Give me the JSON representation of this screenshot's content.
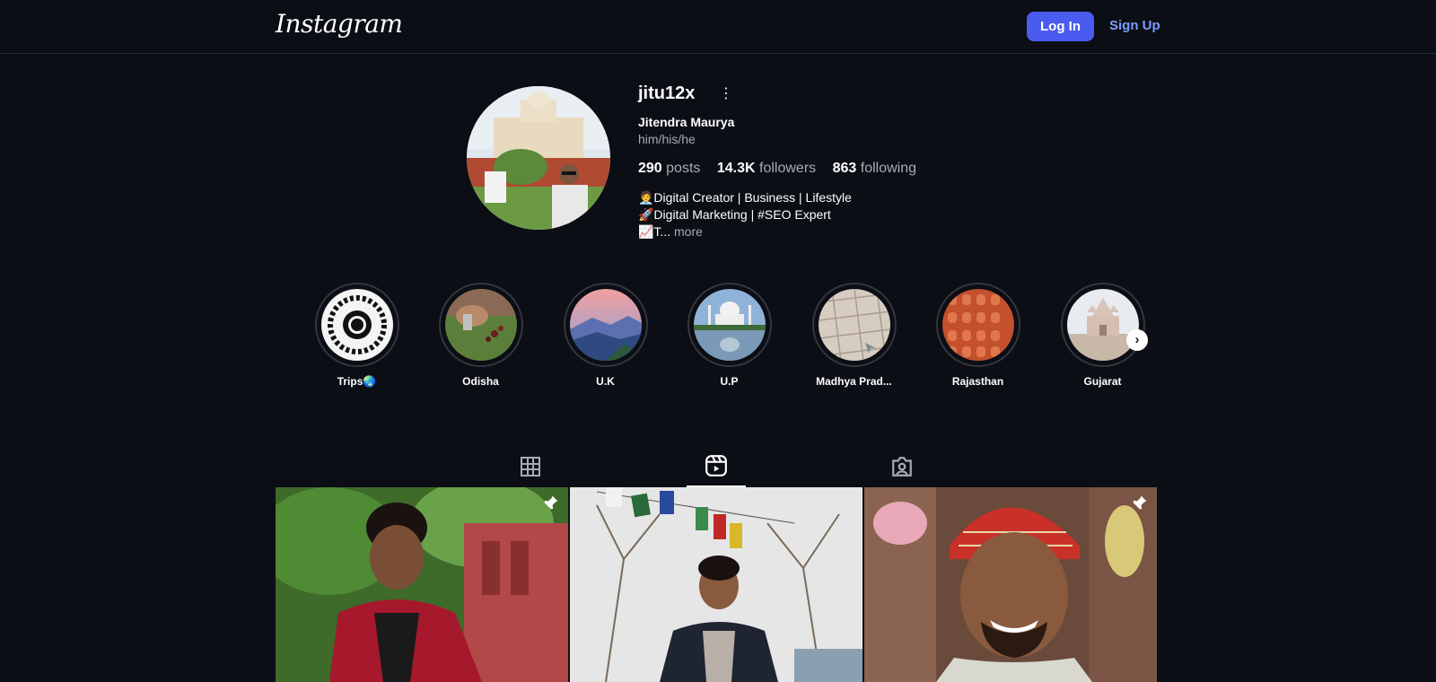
{
  "header": {
    "logo": "Instagram",
    "login_label": "Log In",
    "signup_label": "Sign Up"
  },
  "profile": {
    "username": "jitu12x",
    "full_name": "Jitendra Maurya",
    "pronouns": "him/his/he",
    "stats": {
      "posts_count": "290",
      "posts_label": "posts",
      "followers_count": "14.3K",
      "followers_label": "followers",
      "following_count": "863",
      "following_label": "following"
    },
    "bio": {
      "line1": "🧑‍💼Digital Creator | Business | Lifestyle",
      "line2": "🚀Digital Marketing | #SEO Expert",
      "line3": "📈T...",
      "more": "more"
    }
  },
  "highlights": [
    {
      "label": "Trips🌏",
      "icon": "trips-globe-image"
    },
    {
      "label": "Odisha",
      "icon": "odisha-image"
    },
    {
      "label": "U.K",
      "icon": "uk-mountains-image"
    },
    {
      "label": "U.P",
      "icon": "taj-mahal-image"
    },
    {
      "label": "Madhya Prad...",
      "icon": "paving-tiles-image"
    },
    {
      "label": "Rajasthan",
      "icon": "hawa-mahal-image"
    },
    {
      "label": "Gujarat",
      "icon": "temple-image"
    }
  ],
  "tabs": [
    {
      "name": "posts",
      "icon": "grid-icon"
    },
    {
      "name": "reels",
      "icon": "reels-icon",
      "active": true
    },
    {
      "name": "tagged",
      "icon": "tagged-icon"
    }
  ],
  "colors": {
    "background": "#0b0e14",
    "accent": "#4a5cf0",
    "link": "#7c9cff",
    "muted": "#a8abb3"
  }
}
